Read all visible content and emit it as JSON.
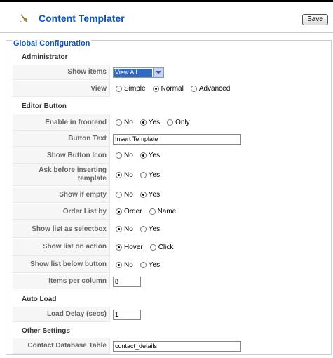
{
  "header": {
    "title": "Content Templater",
    "save_label": "Save"
  },
  "config": {
    "legend": "Global Configuration",
    "sections": {
      "administrator": "Administrator",
      "editor_button": "Editor Button",
      "auto_load": "Auto Load",
      "other_settings": "Other Settings"
    },
    "show_items": {
      "label": "Show items",
      "value": "View All"
    },
    "view": {
      "label": "View",
      "options": [
        "Simple",
        "Normal",
        "Advanced"
      ],
      "selected": "Normal"
    },
    "enable_frontend": {
      "label": "Enable in frontend",
      "options": [
        "No",
        "Yes",
        "Only"
      ],
      "selected": "Yes"
    },
    "button_text": {
      "label": "Button Text",
      "value": "Insert Template"
    },
    "show_button_icon": {
      "label": "Show Button Icon",
      "options": [
        "No",
        "Yes"
      ],
      "selected": "Yes"
    },
    "ask_before": {
      "label_line1": "Ask before inserting",
      "label_line2": "template",
      "options": [
        "No",
        "Yes"
      ],
      "selected": "No"
    },
    "show_if_empty": {
      "label": "Show if empty",
      "options": [
        "No",
        "Yes"
      ],
      "selected": "Yes"
    },
    "order_list_by": {
      "label": "Order List by",
      "options": [
        "Order",
        "Name"
      ],
      "selected": "Order"
    },
    "show_list_selectbox": {
      "label": "Show list as selectbox",
      "options": [
        "No",
        "Yes"
      ],
      "selected": "No"
    },
    "show_list_action": {
      "label": "Show list on action",
      "options": [
        "Hover",
        "Click"
      ],
      "selected": "Hover"
    },
    "show_list_below": {
      "label": "Show list below button",
      "options": [
        "No",
        "Yes"
      ],
      "selected": "No"
    },
    "items_per_column": {
      "label": "Items per column",
      "value": "8"
    },
    "load_delay": {
      "label": "Load Delay (secs)",
      "value": "1"
    },
    "contact_table": {
      "label": "Contact Database Table",
      "value": "contact_details"
    }
  }
}
